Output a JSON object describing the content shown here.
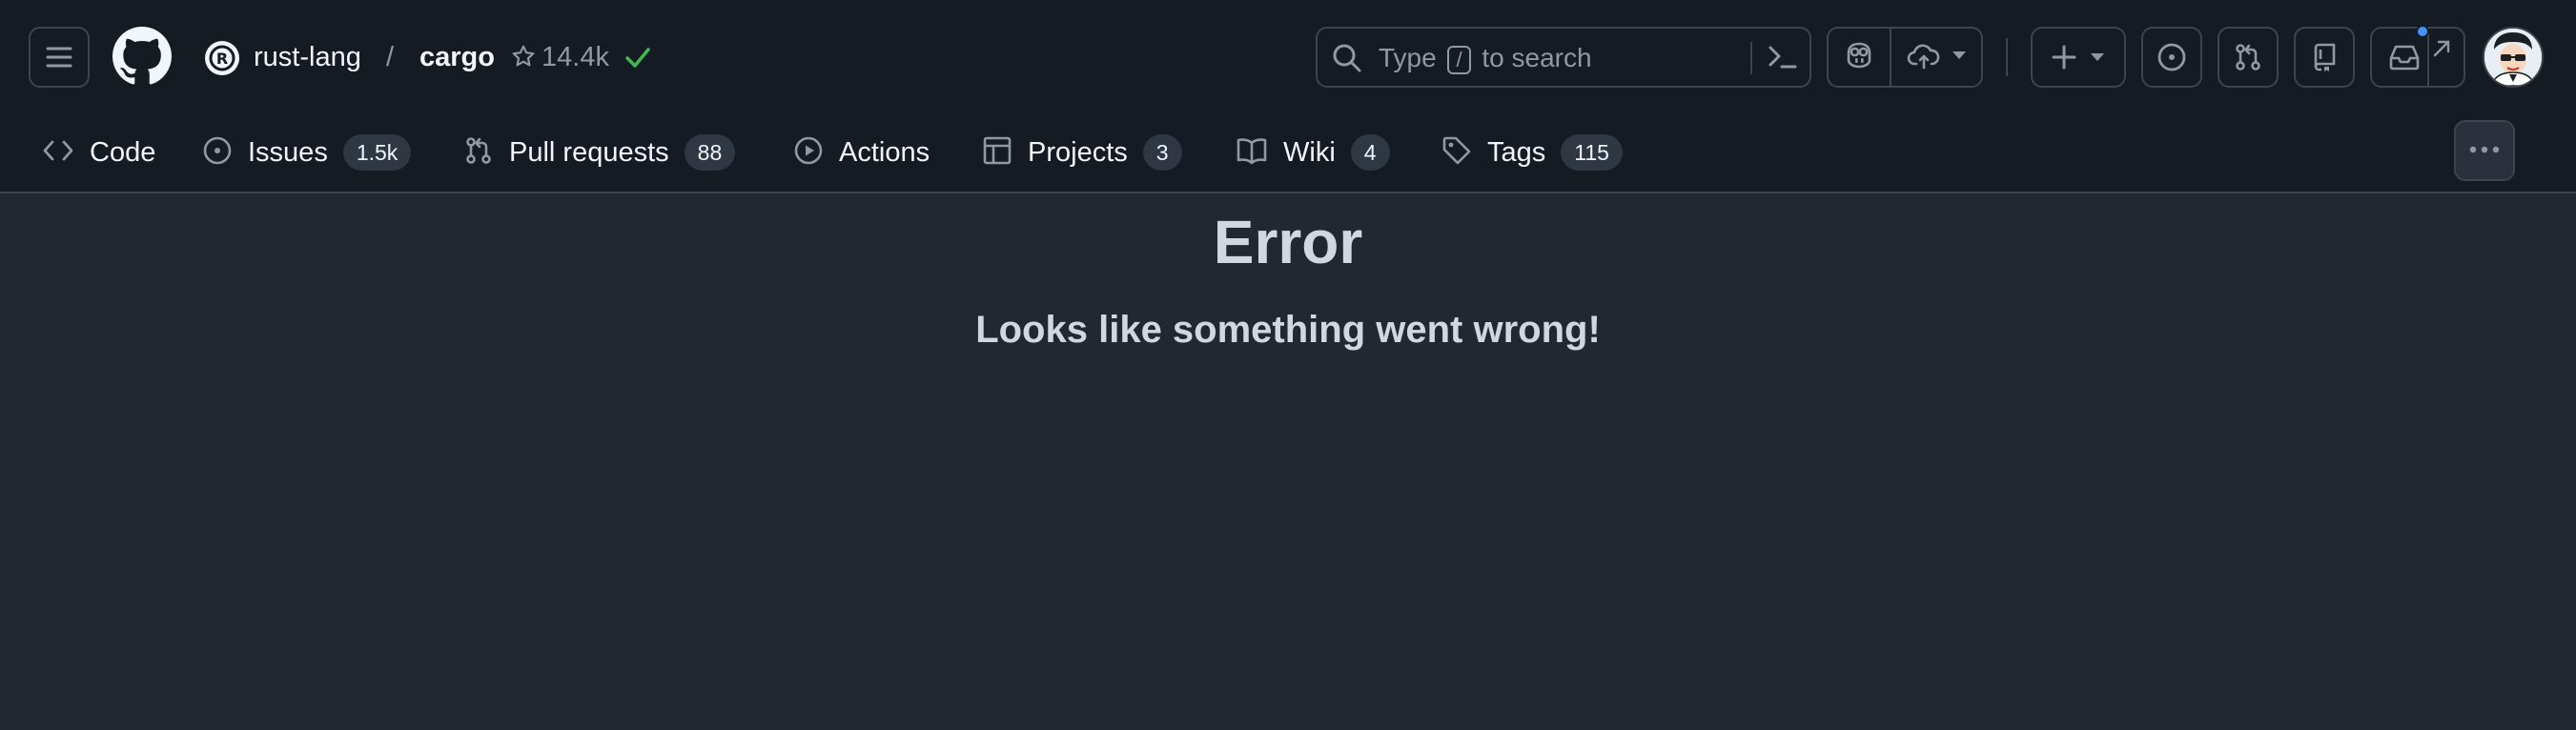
{
  "header": {
    "owner": "rust-lang",
    "separator": "/",
    "repo": "cargo",
    "stars": "14.4k",
    "search": {
      "prefix": "Type",
      "key": "/",
      "suffix": "to search"
    },
    "icons": {
      "menu": "hamburger-icon",
      "logo": "github-logo",
      "star": "star-icon",
      "check": "check-icon",
      "command_palette": "command-palette-icon",
      "copilot": "copilot-icon",
      "create": "plus-icon",
      "issues": "issue-opened-icon",
      "pull_requests": "git-pull-request-icon",
      "repositories": "repo-icon",
      "inbox": "inbox-icon",
      "more": "kebab-horizontal-icon"
    }
  },
  "tabs": [
    {
      "label": "Code",
      "icon": "code-icon",
      "count": null
    },
    {
      "label": "Issues",
      "icon": "issue-opened-icon",
      "count": "1.5k"
    },
    {
      "label": "Pull requests",
      "icon": "git-pull-request-icon",
      "count": "88"
    },
    {
      "label": "Actions",
      "icon": "play-icon",
      "count": null
    },
    {
      "label": "Projects",
      "icon": "table-icon",
      "count": "3"
    },
    {
      "label": "Wiki",
      "icon": "book-icon",
      "count": "4"
    },
    {
      "label": "Tags",
      "icon": "tag-icon",
      "count": "115"
    }
  ],
  "main": {
    "title": "Error",
    "message": "Looks like something went wrong!"
  },
  "colors": {
    "header_bg": "#151b23",
    "page_bg": "#212830",
    "border": "#3d444d",
    "text": "#f0f6fc",
    "muted": "#9198a1",
    "success": "#3fb950",
    "accent": "#4493f8"
  }
}
